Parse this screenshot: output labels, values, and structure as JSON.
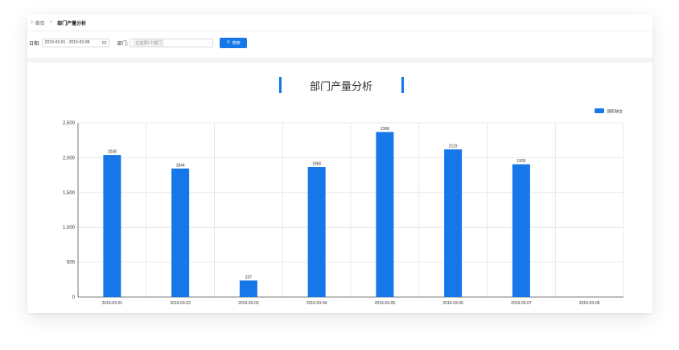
{
  "breadcrumb": {
    "home": "首页",
    "separator": ">",
    "current": "部门产量分析"
  },
  "filters": {
    "date_label": "日期:",
    "date_range": "2019-03-01 - 2019-03-08",
    "dept_label": "部门:",
    "dept_placeholder": "已选择1个部门",
    "search_label": "搜索"
  },
  "colors": {
    "bar": "#1677e8",
    "accent": "#1677e8"
  },
  "chart_data": {
    "type": "bar",
    "title": "部门产量分析",
    "categories": [
      "2019-03-01",
      "2019-03-02",
      "2019-03-03",
      "2019-03-04",
      "2019-03-05",
      "2019-03-06",
      "2019-03-07",
      "2019-03-08"
    ],
    "series": [
      {
        "name": "测阶缺合",
        "values": [
          2038,
          1844,
          237,
          1866,
          2368,
          2119,
          1905,
          null
        ]
      }
    ],
    "yticks": [
      "0",
      "500",
      "1,000",
      "1,500",
      "2,000",
      "2,500"
    ],
    "ylim": [
      0,
      2500
    ],
    "grid": true,
    "legend": "top-right"
  }
}
